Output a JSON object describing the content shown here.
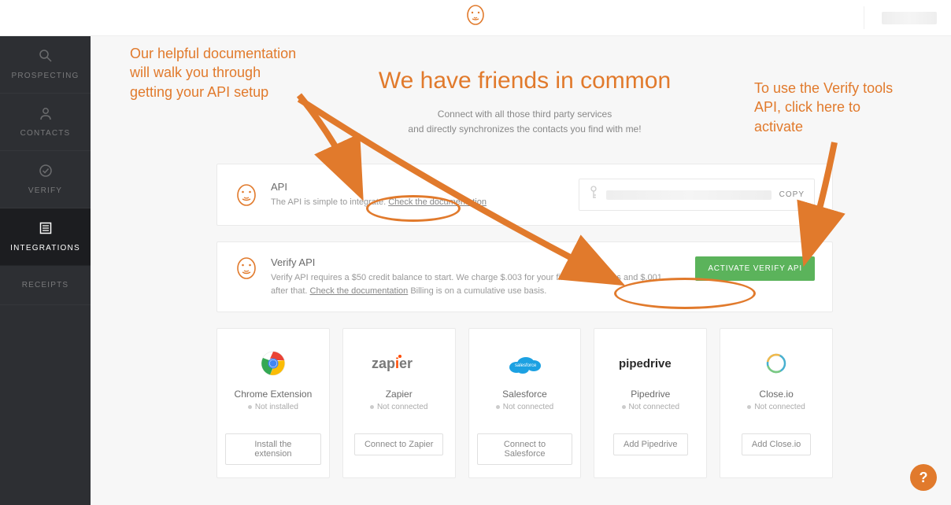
{
  "sidebar": {
    "items": [
      {
        "label": "PROSPECTING"
      },
      {
        "label": "CONTACTS"
      },
      {
        "label": "VERIFY"
      },
      {
        "label": "INTEGRATIONS"
      },
      {
        "label": "RECEIPTS"
      }
    ]
  },
  "page": {
    "heading": "We have friends in common",
    "subtitle_line1": "Connect with all those third party services",
    "subtitle_line2": "and directly synchronizes the contacts you find with me!"
  },
  "api_card": {
    "title": "API",
    "desc_prefix": "The API is simple to integrate. ",
    "doc_link": "Check the documentation",
    "copy_label": "COPY"
  },
  "verify_card": {
    "title": "Verify API",
    "desc_prefix": "Verify API requires a $50 credit balance to start. We charge $.003 for your first 500k verifies and $.001 after that. ",
    "doc_link": "Check the documentation",
    "desc_suffix": " Billing is on a cumulative use basis.",
    "button": "ACTIVATE VERIFY API"
  },
  "integrations": [
    {
      "title": "Chrome Extension",
      "status": "Not installed",
      "button": "Install the extension"
    },
    {
      "title": "Zapier",
      "status": "Not connected",
      "button": "Connect to Zapier"
    },
    {
      "title": "Salesforce",
      "status": "Not connected",
      "button": "Connect to Salesforce"
    },
    {
      "title": "Pipedrive",
      "status": "Not connected",
      "button": "Add Pipedrive"
    },
    {
      "title": "Close.io",
      "status": "Not connected",
      "button": "Add Close.io"
    }
  ],
  "annotations": {
    "left": "Our helpful documentation will walk you through getting your API setup",
    "right": "To use the Verify tools API, click here to activate"
  },
  "help": "?"
}
